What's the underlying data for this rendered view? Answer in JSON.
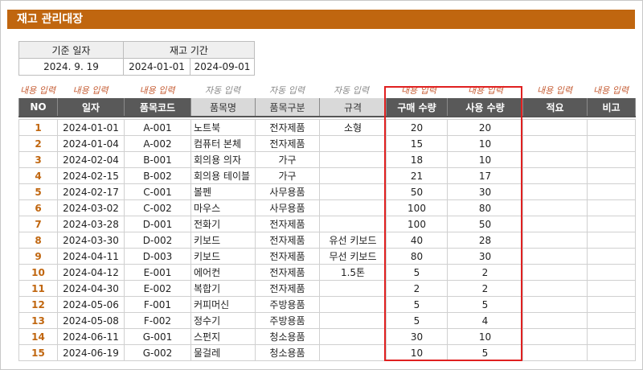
{
  "title": "재고 관리대장",
  "info": {
    "base_date_label": "기준 일자",
    "period_label": "재고 기간",
    "base_date": "2024. 9. 19",
    "period_start": "2024-01-01",
    "period_end": "2024-09-01"
  },
  "input_labels": {
    "manual": "내용 입력",
    "auto": "자동 입력"
  },
  "columns": [
    "NO",
    "일자",
    "품목코드",
    "품목명",
    "품목구분",
    "규격",
    "구매 수량",
    "사용 수량",
    "적요",
    "비고"
  ],
  "rows": [
    {
      "no": "1",
      "date": "2024-01-01",
      "code": "A-001",
      "name": "노트북",
      "category": "전자제품",
      "spec": "소형",
      "buy": "20",
      "use": "20"
    },
    {
      "no": "2",
      "date": "2024-01-04",
      "code": "A-002",
      "name": "컴퓨터 본체",
      "category": "전자제품",
      "spec": "",
      "buy": "15",
      "use": "10"
    },
    {
      "no": "3",
      "date": "2024-02-04",
      "code": "B-001",
      "name": "회의용 의자",
      "category": "가구",
      "spec": "",
      "buy": "18",
      "use": "10"
    },
    {
      "no": "4",
      "date": "2024-02-15",
      "code": "B-002",
      "name": "회의용 테이블",
      "category": "가구",
      "spec": "",
      "buy": "21",
      "use": "17"
    },
    {
      "no": "5",
      "date": "2024-02-17",
      "code": "C-001",
      "name": "볼펜",
      "category": "사무용품",
      "spec": "",
      "buy": "50",
      "use": "30"
    },
    {
      "no": "6",
      "date": "2024-03-02",
      "code": "C-002",
      "name": "마우스",
      "category": "사무용품",
      "spec": "",
      "buy": "100",
      "use": "80"
    },
    {
      "no": "7",
      "date": "2024-03-28",
      "code": "D-001",
      "name": "전화기",
      "category": "전자제품",
      "spec": "",
      "buy": "100",
      "use": "50"
    },
    {
      "no": "8",
      "date": "2024-03-30",
      "code": "D-002",
      "name": "키보드",
      "category": "전자제품",
      "spec": "유선 키보드",
      "buy": "40",
      "use": "28"
    },
    {
      "no": "9",
      "date": "2024-04-11",
      "code": "D-003",
      "name": "키보드",
      "category": "전자제품",
      "spec": "무선 키보드",
      "buy": "80",
      "use": "30"
    },
    {
      "no": "10",
      "date": "2024-04-12",
      "code": "E-001",
      "name": "에어컨",
      "category": "전자제품",
      "spec": "1.5톤",
      "buy": "5",
      "use": "2"
    },
    {
      "no": "11",
      "date": "2024-04-30",
      "code": "E-002",
      "name": "복합기",
      "category": "전자제품",
      "spec": "",
      "buy": "2",
      "use": "2"
    },
    {
      "no": "12",
      "date": "2024-05-06",
      "code": "F-001",
      "name": "커피머신",
      "category": "주방용품",
      "spec": "",
      "buy": "5",
      "use": "5"
    },
    {
      "no": "13",
      "date": "2024-05-08",
      "code": "F-002",
      "name": "정수기",
      "category": "주방용품",
      "spec": "",
      "buy": "5",
      "use": "4"
    },
    {
      "no": "14",
      "date": "2024-06-11",
      "code": "G-001",
      "name": "스펀지",
      "category": "청소용품",
      "spec": "",
      "buy": "30",
      "use": "10"
    },
    {
      "no": "15",
      "date": "2024-06-19",
      "code": "G-002",
      "name": "물걸레",
      "category": "청소용품",
      "spec": "",
      "buy": "10",
      "use": "5"
    }
  ]
}
